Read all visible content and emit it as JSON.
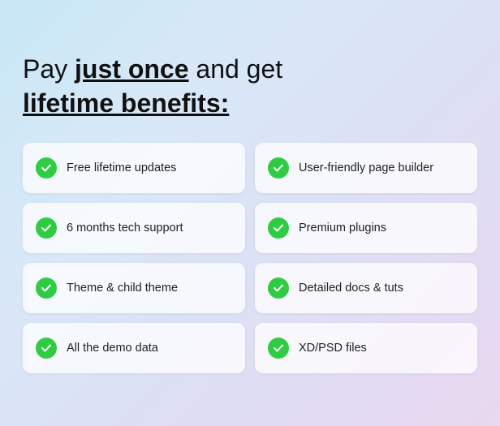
{
  "headline": {
    "line1_normal": "Pay ",
    "line1_bold": "just once",
    "line1_end": " and get",
    "line2": "lifetime benefits:"
  },
  "benefits": [
    {
      "id": "free-updates",
      "label": "Free lifetime updates"
    },
    {
      "id": "user-friendly",
      "label": "User-friendly page builder"
    },
    {
      "id": "tech-support",
      "label": "6 months tech support"
    },
    {
      "id": "premium-plugins",
      "label": "Premium plugins"
    },
    {
      "id": "child-theme",
      "label": "Theme & child theme"
    },
    {
      "id": "detailed-docs",
      "label": "Detailed docs & tuts"
    },
    {
      "id": "demo-data",
      "label": "All the demo data"
    },
    {
      "id": "xd-psd",
      "label": "XD/PSD files"
    }
  ]
}
